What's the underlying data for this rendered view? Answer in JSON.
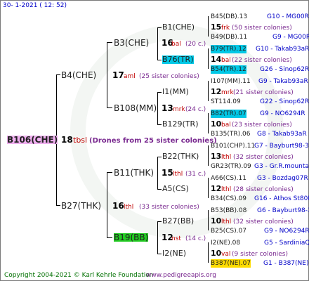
{
  "header": "30-   1-2021  ( 12:  52)",
  "footer": {
    "copyright": "Copyright 2004-2021 © Karl Kehrle Foundation",
    "site": "www.pedigreeapis.org"
  },
  "root": {
    "name": "B106(CHE)",
    "num": "18",
    "abbr": "tbsl",
    "desc": "(Drones from 25 sister colonies)"
  },
  "g1": [
    {
      "name": "B4(CHE)",
      "num": "17",
      "abbr": "aml",
      "desc": "(25 sister colonies)"
    },
    {
      "name": "B27(THK)",
      "num": "16",
      "abbr": "lthl",
      "desc": "(33 sister colonies)"
    }
  ],
  "g2": [
    {
      "name": "B3(CHE)",
      "num": "16",
      "abbr": "bal",
      "desc": "(20 c.)"
    },
    {
      "name": "B108(MM)",
      "num": "13",
      "abbr": "mrk",
      "desc": "(24 c.)"
    },
    {
      "name": "B11(THK)",
      "num": "15",
      "abbr": "lthl",
      "desc": "(31 c.)"
    },
    {
      "name": "B19(BB)",
      "num": "12",
      "abbr": "nst",
      "desc": "(14 c.)"
    }
  ],
  "g3": [
    {
      "name": "B1(CHE)"
    },
    {
      "name": "B76(TR)"
    },
    {
      "name": "I1(MM)"
    },
    {
      "name": "B129(TR)"
    },
    {
      "name": "B22(THK)"
    },
    {
      "name": "A5(CS)"
    },
    {
      "name": "B27(BB)"
    },
    {
      "name": "I2(NE)"
    }
  ],
  "g4": [
    {
      "top": "B45(DB).13",
      "topr": "G10 - MG00R",
      "num": "15",
      "abbr": "frk",
      "desc": "(50 sister colonies)",
      "bot": "B49(DB).11",
      "botr": "G9 - MG00R"
    },
    {
      "top": "B79(TR).12",
      "topr": "G10 - Takab93aR",
      "num": "14",
      "abbr": "bal",
      "desc": "(22 sister colonies)",
      "bot": "B54(TR).12",
      "botr": "G26 - Sinop62R"
    },
    {
      "top": "I107(MM).11",
      "topr": "G9 - Takab93aR",
      "num": "12",
      "abbr": "mrk",
      "desc": "(21 sister colonies)",
      "bot": "ST114.09",
      "botr": "G22 - Sinop62R"
    },
    {
      "top": "B82(TR).07",
      "topr": "G9 - NO6294R",
      "num": "10",
      "abbr": "bal",
      "desc": "(23 sister colonies)",
      "bot": "B135(TR).06",
      "botr": "G8 - Takab93aR"
    },
    {
      "top": "B101(CHP).11",
      "topr": "G7 - Bayburt98-3",
      "num": "13",
      "abbr": "lthl",
      "desc": "(32 sister colonies)",
      "bot": "GR23(TR).09",
      "botr": "G3 - Gr.R.mounta"
    },
    {
      "top": "A66(CS).11",
      "topr": "G3 - Bozdag07R",
      "num": "12",
      "abbr": "lthl",
      "desc": "(28 sister colonies)",
      "bot": "B34(CS).09",
      "botr": "G16 - Athos St80R"
    },
    {
      "top": "B53(BB).08",
      "topr": "G6 - Bayburt98-3",
      "num": "10",
      "abbr": "lthl",
      "desc": "(32 sister colonies)",
      "bot": "B25(CS).07",
      "botr": "G9 - NO6294R"
    },
    {
      "top": "I2(NE).08",
      "topr": "G5 - SardiniaQ",
      "num": "10",
      "abbr": "val",
      "desc": "(9 sister colonies)",
      "bot": "B387(NE).07",
      "botr": "G1 - B387(NE)"
    }
  ]
}
